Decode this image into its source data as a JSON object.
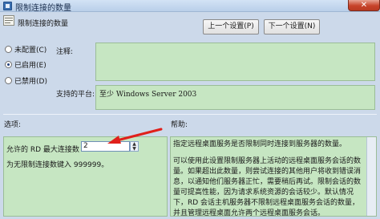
{
  "window": {
    "title": "限制连接的数量",
    "close_label": "✕"
  },
  "setting": {
    "title": "限制连接的数量"
  },
  "nav": {
    "prev_label": "上一个设置(P)",
    "next_label": "下一个设置(N)"
  },
  "state": {
    "options": [
      {
        "label": "未配置(C)",
        "selected": false
      },
      {
        "label": "已启用(E)",
        "selected": true
      },
      {
        "label": "已禁用(D)",
        "selected": false
      }
    ]
  },
  "fields": {
    "comment_label": "注释:",
    "comment_value": "",
    "platform_label": "支持的平台:",
    "platform_value": "至少 Windows Server 2003"
  },
  "options_section": {
    "label": "选项:",
    "max_connections_label": "允许的 RD 最大连接数",
    "max_connections_value": "2",
    "hint": "为无限制连接数键入 999999。"
  },
  "help_section": {
    "label": "帮助:",
    "paragraphs": [
      "指定远程桌面服务是否限制同时连接到服务器的数量。",
      "可以使用此设置限制服务器上活动的远程桌面服务会话的数量。如果超出此数量，则尝试连接的其他用户将收到错误消息，以通知他们服务器正忙，需要稍后再试。限制会话的数量可提高性能，因为请求系统资源的会话较少。默认情况下，RD 会话主机服务器不限制远程桌面服务会话的数量，并且管理远程桌面允许两个远程桌面服务会话。"
    ]
  },
  "colors": {
    "panel_green": "#c6e6c2",
    "arrow_red": "#e0201b",
    "window_bg": "#ccd9ea"
  }
}
